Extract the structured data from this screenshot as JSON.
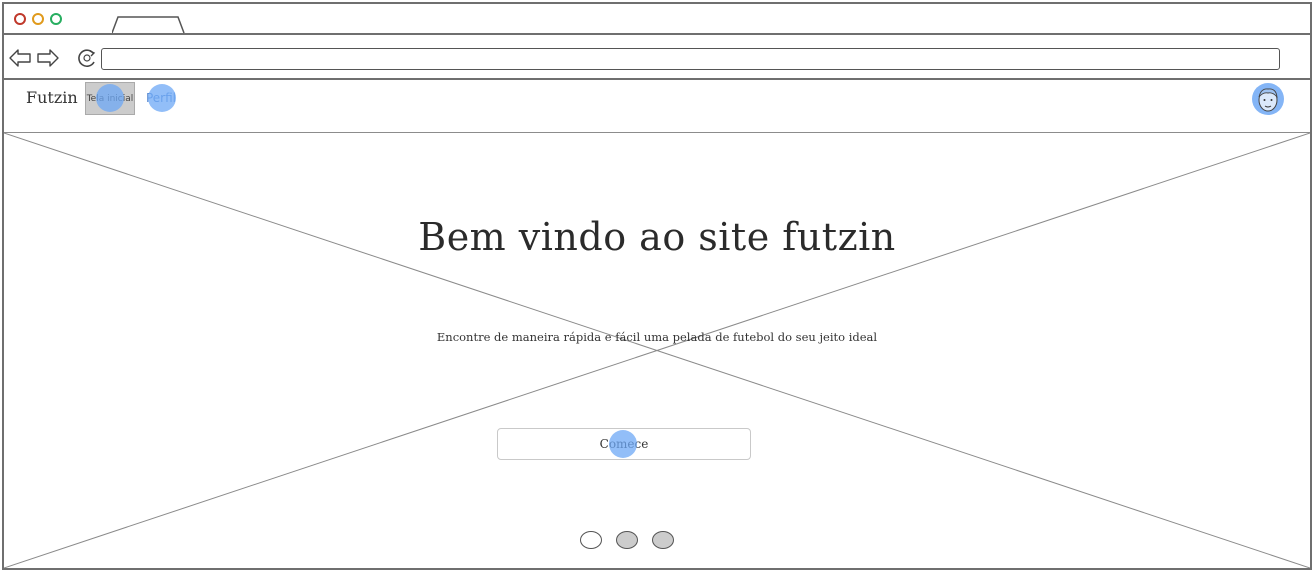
{
  "browser": {
    "url": "",
    "window_controls": [
      "close",
      "minimize",
      "maximize"
    ],
    "colors": {
      "close": "#c0392b",
      "minimize": "#e09a1c",
      "maximize": "#27ae60"
    }
  },
  "nav": {
    "brand": "Futzin",
    "links": [
      {
        "label": "Tela inicial",
        "active": true
      },
      {
        "label": "Perfil",
        "active": false
      }
    ],
    "avatar_icon": "user-avatar-icon"
  },
  "hero": {
    "title": "Bem vindo ao site futzin",
    "subtitle": "Encontre de maneira rápida e fácil uma pelada de futebol do seu jeito ideal",
    "cta_label": "Comece",
    "carousel_dots": [
      {
        "active": true
      },
      {
        "active": false
      },
      {
        "active": false
      }
    ]
  },
  "colors": {
    "accent_click": "#6ea8f5",
    "frame": "#6f6f6f",
    "dot_inactive": "#cccccc"
  }
}
